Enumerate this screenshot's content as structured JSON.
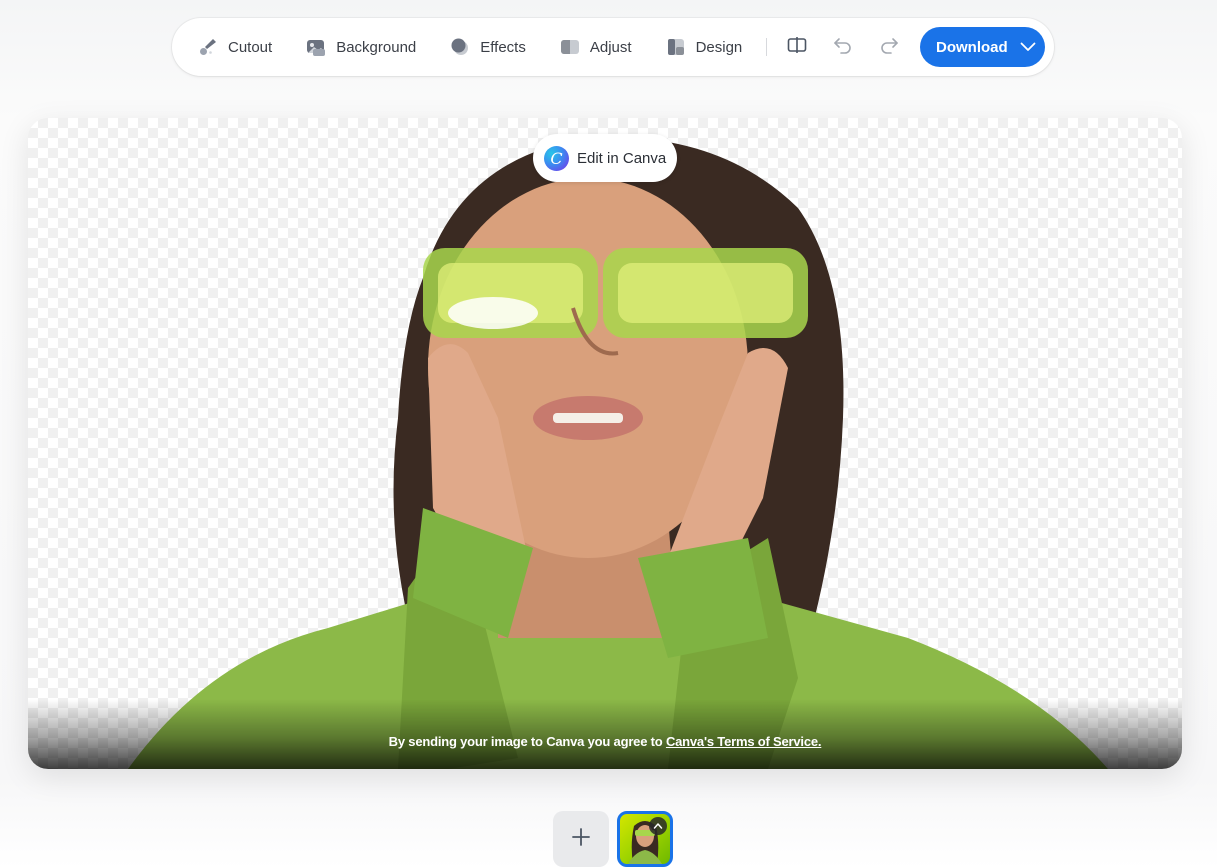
{
  "toolbar": {
    "tools": [
      {
        "label": "Cutout",
        "icon": "brush-icon"
      },
      {
        "label": "Background",
        "icon": "image-icon"
      },
      {
        "label": "Effects",
        "icon": "circles-icon"
      },
      {
        "label": "Adjust",
        "icon": "adjust-icon"
      },
      {
        "label": "Design",
        "icon": "layout-icon"
      }
    ],
    "compare_icon": "compare-icon",
    "undo_icon": "undo-icon",
    "redo_icon": "redo-icon",
    "download_label": "Download",
    "download_color": "#1a73e8"
  },
  "canvas": {
    "edit_button_label": "Edit in Canva",
    "legal_text": "By sending your image to Canva you agree to ",
    "legal_link": "Canva's Terms of Service."
  },
  "thumbnails": {
    "add_icon": "plus-icon",
    "selected_border_color": "#1a73e8"
  }
}
